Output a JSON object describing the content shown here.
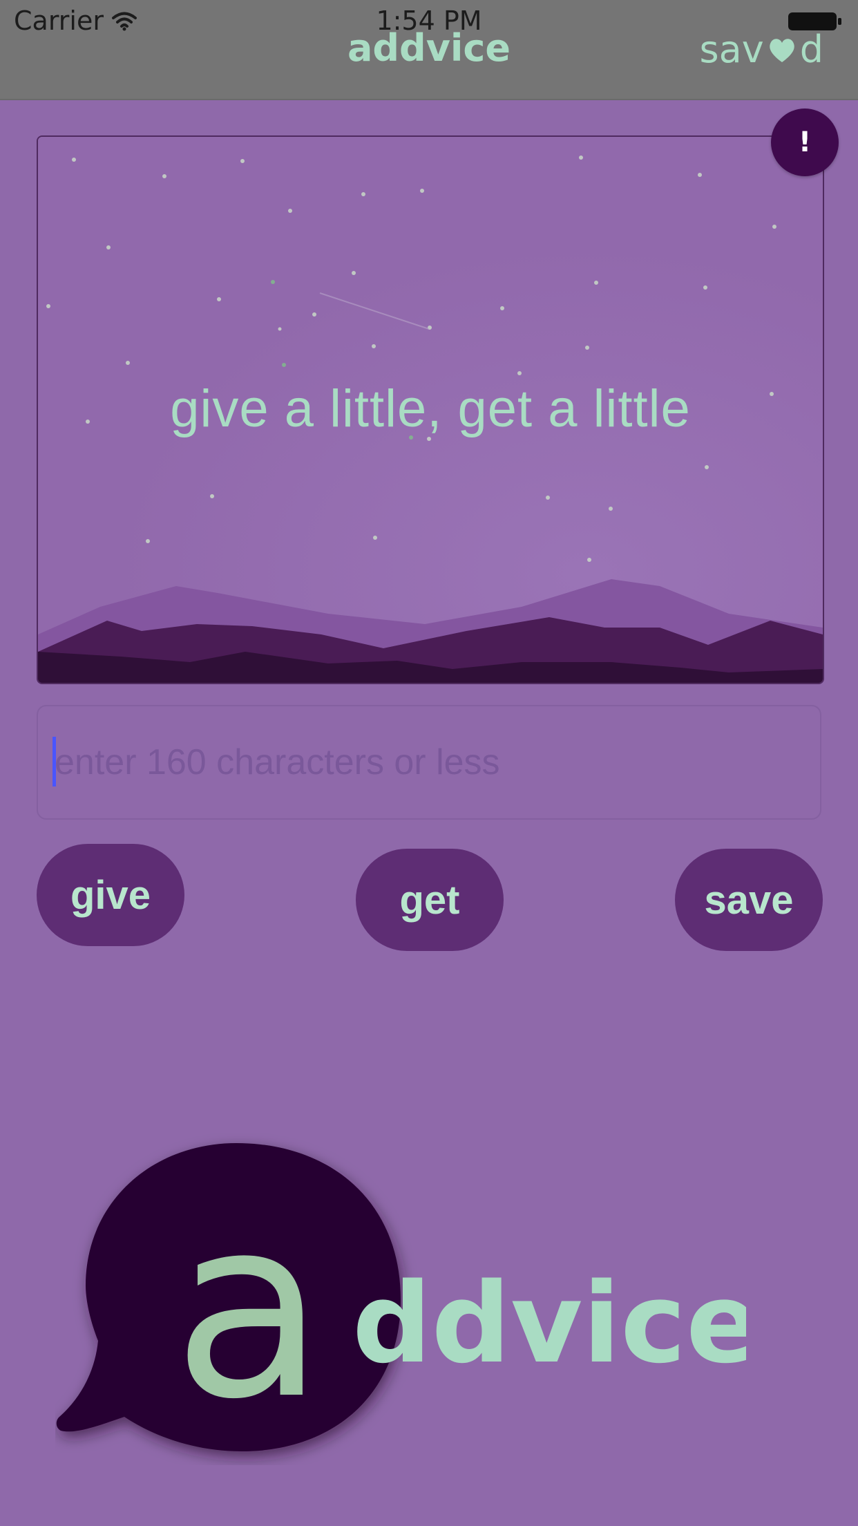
{
  "status_bar": {
    "carrier": "Carrier",
    "time": "1:54 PM",
    "icons": [
      "wifi-icon",
      "battery-icon"
    ]
  },
  "nav": {
    "title": "addvice",
    "saved_prefix": "sav",
    "saved_suffix": "d",
    "saved_icon": "heart-icon"
  },
  "hero": {
    "tagline": "give a little, get a little",
    "alert_label": "!"
  },
  "input": {
    "placeholder": "enter 160 characters or less",
    "value": ""
  },
  "buttons": {
    "give": "give",
    "get": "get",
    "save": "save"
  },
  "logo": {
    "letter": "a",
    "rest": "ddvice"
  },
  "colors": {
    "background": "#8f69aa",
    "nav_bar": "#757575",
    "accent_mint": "#a9dcc3",
    "button": "#5e2d74",
    "dark_purple": "#280030"
  }
}
